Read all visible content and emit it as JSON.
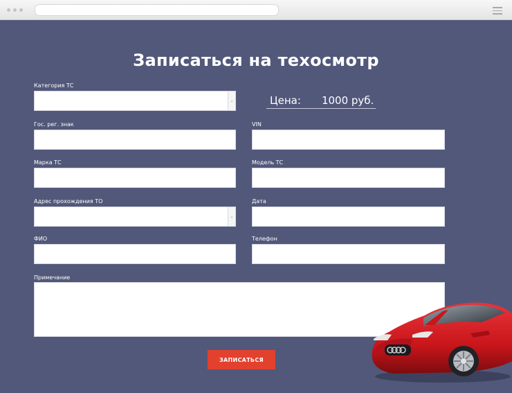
{
  "form": {
    "title": "Записаться на техосмотр",
    "fields": {
      "vehicle_category": {
        "label": "Категория ТС",
        "value": ""
      },
      "reg_plate": {
        "label": "Гос. рег. знак",
        "value": ""
      },
      "vin": {
        "label": "VIN",
        "value": ""
      },
      "brand": {
        "label": "Марка ТС",
        "value": ""
      },
      "model": {
        "label": "Модель ТС",
        "value": ""
      },
      "inspection_address": {
        "label": "Адрес прохождения ТО",
        "value": ""
      },
      "date": {
        "label": "Дата",
        "value": ""
      },
      "full_name": {
        "label": "ФИО",
        "value": ""
      },
      "phone": {
        "label": "Телефон",
        "value": ""
      },
      "note": {
        "label": "Примечание",
        "value": ""
      }
    },
    "price": {
      "label": "Цена:",
      "value": "1000 руб."
    },
    "submit_label": "ЗАПИСАТЬСЯ"
  },
  "colors": {
    "background": "#52587a",
    "accent_button": "#e2412e",
    "car_body": "#c8161b"
  },
  "icons": {
    "select_arrow": "chevron-down-icon",
    "menu": "hamburger-menu-icon"
  }
}
